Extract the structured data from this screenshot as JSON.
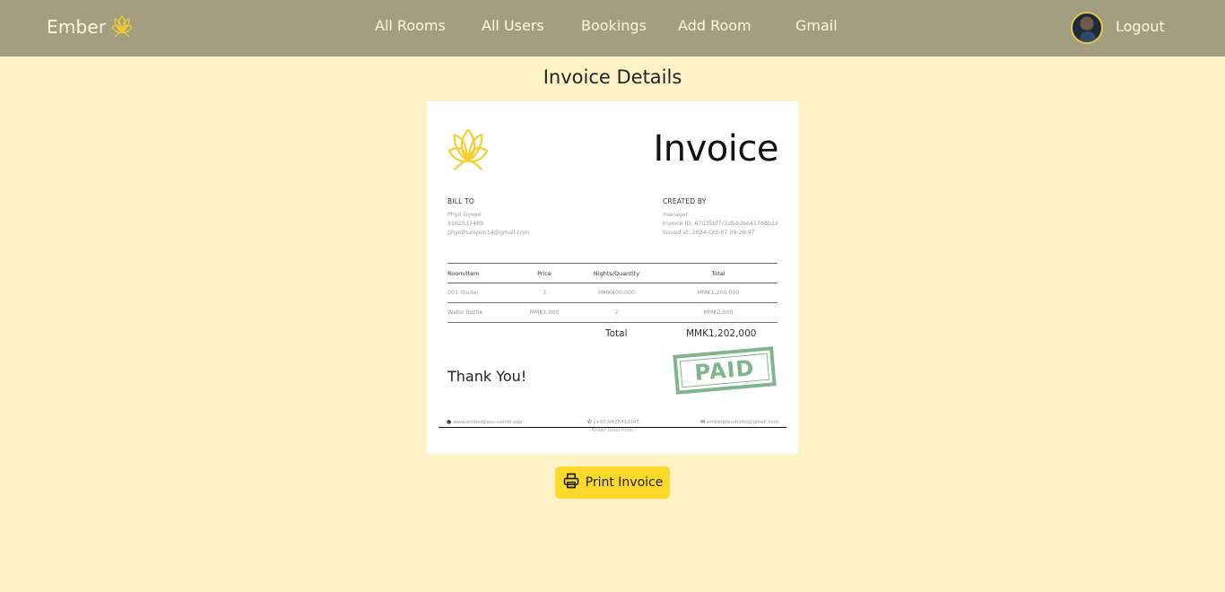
{
  "brand": {
    "name": "Ember",
    "accent": "#f3cf2c",
    "logo_icon": "lotus-icon"
  },
  "nav": {
    "links": [
      "All Rooms",
      "All Users",
      "Bookings",
      "Add Room",
      "Gmail"
    ],
    "logout": "Logout",
    "avatar_icon": "user-avatar"
  },
  "page": {
    "title": "Invoice Details"
  },
  "invoice": {
    "heading": "Invoice",
    "bill_to": {
      "title": "BILL TO",
      "name": "Phyo Gyeee",
      "phone": "9162537489",
      "email": "phyothuriyein14@gmail.com"
    },
    "created_by": {
      "title": "CREATED BY",
      "role": "manager",
      "invoice_id": "Invoice ID: 67035bf7c5d5636e41768b22",
      "issued_at": "Issued at: 2024-Oct-07 09:26:47"
    },
    "columns": [
      "Room/Item",
      "Price",
      "Nights/Quantity",
      "Total"
    ],
    "rows": [
      {
        "item": "001 (Suite)",
        "price": "3",
        "qty": "MMK400,000",
        "total": "MMK1,200,000"
      },
      {
        "item": "Water Bottle",
        "price": "MMK1,000",
        "qty": "2",
        "total": "MMK2,000"
      }
    ],
    "total_label": "Total",
    "total_value": "MMK1,202,000",
    "thanks": "Thank You!",
    "stamp": "PAID",
    "stamp_color": "#7fb58a",
    "footer": {
      "website": "www.emberglass.vercel.app",
      "phone": "(+95)9425412345",
      "email": "emberglasshotel@gmail.com",
      "company": "- Ember Glass Hotel -"
    }
  },
  "print_button": {
    "label": "Print Invoice",
    "icon": "printer-icon",
    "color": "#fcd92b"
  }
}
